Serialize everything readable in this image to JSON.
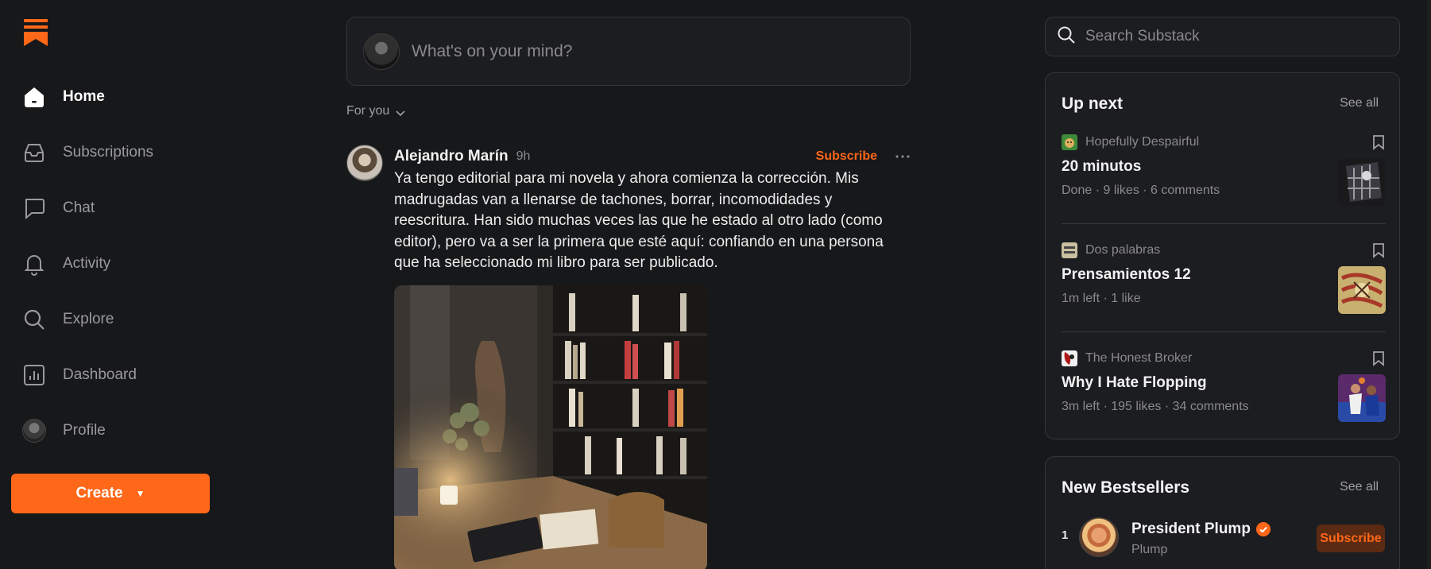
{
  "sidebar": {
    "logo_icon": "substack-logo-icon",
    "items": [
      {
        "label": "Home",
        "icon": "home-icon",
        "active": true
      },
      {
        "label": "Subscriptions",
        "icon": "inbox-icon"
      },
      {
        "label": "Chat",
        "icon": "chat-bubble-icon"
      },
      {
        "label": "Activity",
        "icon": "bell-icon"
      },
      {
        "label": "Explore",
        "icon": "search-icon"
      },
      {
        "label": "Dashboard",
        "icon": "bar-chart-icon"
      },
      {
        "label": "Profile",
        "icon": "avatar"
      }
    ],
    "create_label": "Create"
  },
  "composer": {
    "placeholder": "What's on your mind?"
  },
  "feed": {
    "filter_label": "For you"
  },
  "post": {
    "author": "Alejandro Marín",
    "time": "9h",
    "subscribe_label": "Subscribe",
    "body": "Ya tengo editorial para mi novela y ahora comienza la corrección. Mis madrugadas van a llenarse de tachones, borrar, incomodidades y reescritura. Han sido muchas veces las que he estado al otro lado (como editor), pero va a ser la primera que esté aquí: confiando en una persona que ha seleccionado mi libro para ser publicado."
  },
  "search": {
    "placeholder": "Search Substack"
  },
  "up_next": {
    "title": "Up next",
    "see_all": "See all",
    "items": [
      {
        "publication": "Hopefully Despairful",
        "title": "20 minutos",
        "meta": "Done · 9 likes · 6 comments"
      },
      {
        "publication": "Dos palabras",
        "title": "Prensamientos 12",
        "meta": "1m left · 1 like"
      },
      {
        "publication": "The Honest Broker",
        "title": "Why I Hate Flopping",
        "meta": "3m left · 195 likes · 34 comments"
      }
    ]
  },
  "bestsellers": {
    "title": "New Bestsellers",
    "see_all": "See all",
    "items": [
      {
        "rank": "1",
        "name": "President Plump",
        "subtitle": "Plump",
        "subscribe_label": "Subscribe",
        "verified": true
      }
    ]
  },
  "colors": {
    "accent": "#ff6719",
    "background": "#17181a",
    "card": "#1c1d20",
    "border": "#343538",
    "muted_text": "#8a8a8e"
  }
}
